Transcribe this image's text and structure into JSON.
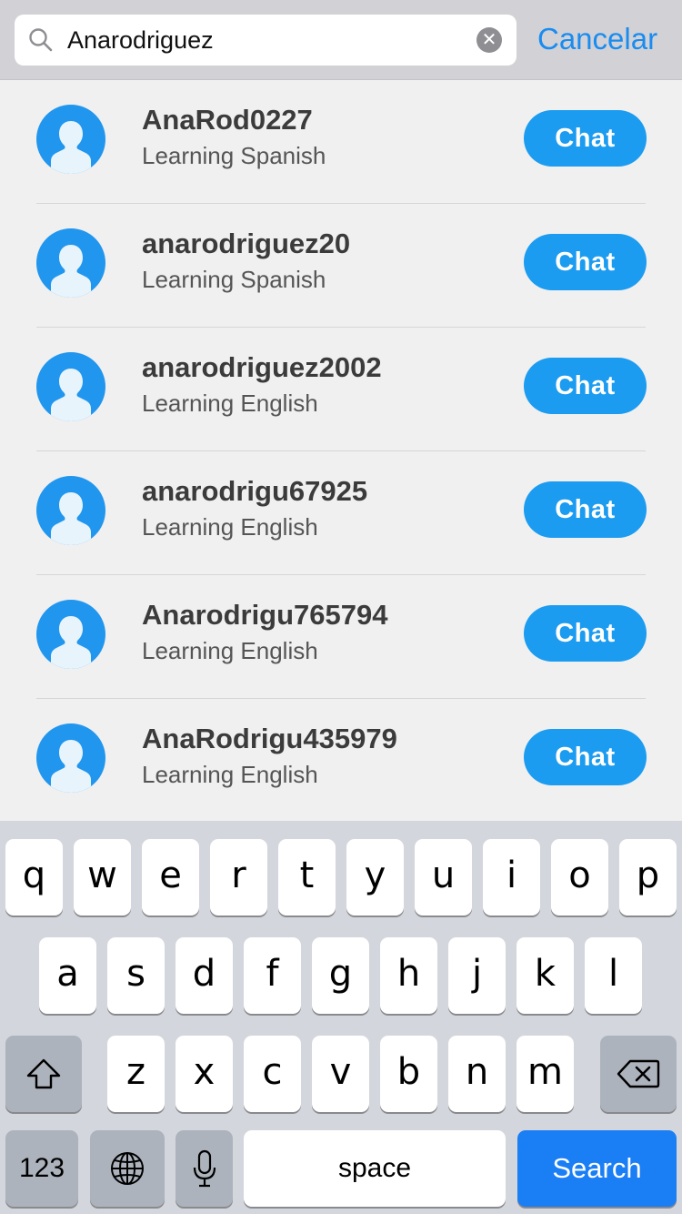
{
  "search": {
    "value": "Anarodriguez",
    "placeholder": "",
    "cancel_label": "Cancelar"
  },
  "results": [
    {
      "username": "AnaRod0227",
      "learning": "Learning Spanish",
      "action": "Chat"
    },
    {
      "username": "anarodriguez20",
      "learning": "Learning Spanish",
      "action": "Chat"
    },
    {
      "username": "anarodriguez2002",
      "learning": "Learning English",
      "action": "Chat"
    },
    {
      "username": "anarodrigu67925",
      "learning": "Learning English",
      "action": "Chat"
    },
    {
      "username": "Anarodrigu765794",
      "learning": "Learning English",
      "action": "Chat"
    },
    {
      "username": "AnaRodrigu435979",
      "learning": "Learning English",
      "action": "Chat"
    }
  ],
  "keyboard": {
    "row1": [
      "q",
      "w",
      "e",
      "r",
      "t",
      "y",
      "u",
      "i",
      "o",
      "p"
    ],
    "row2": [
      "a",
      "s",
      "d",
      "f",
      "g",
      "h",
      "j",
      "k",
      "l"
    ],
    "row3": [
      "z",
      "x",
      "c",
      "v",
      "b",
      "n",
      "m"
    ],
    "numbers_label": "123",
    "space_label": "space",
    "search_label": "Search",
    "icons": {
      "shift": "shift-icon",
      "delete": "backspace-icon",
      "globe": "globe-icon",
      "mic": "microphone-icon",
      "search_field": "search-icon",
      "clear": "clear-icon",
      "avatar": "user-avatar-icon"
    }
  },
  "colors": {
    "accent": "#1a8cf0",
    "chat_button": "#1c9cf0",
    "avatar_bg": "#2196ee",
    "search_key": "#1a7ef5"
  }
}
